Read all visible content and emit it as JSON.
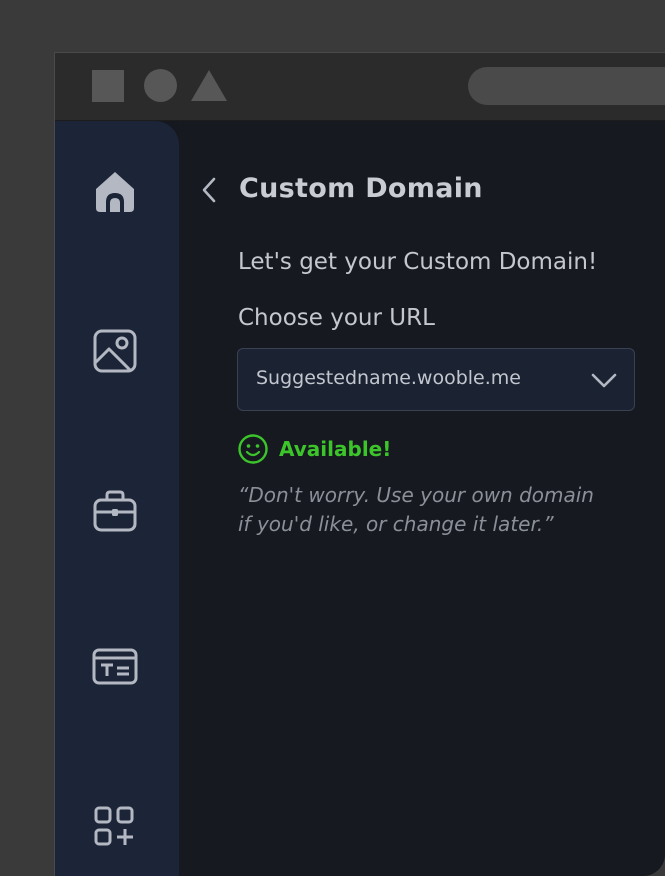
{
  "header": {
    "back_label": "back",
    "title": "Custom Domain"
  },
  "main": {
    "headline": "Let's get your Custom Domain!",
    "url_label": "Choose your URL",
    "url_select": {
      "selected_value": "Suggestedname.wooble.me"
    },
    "status": {
      "text": "Available!",
      "color": "#3cc52a",
      "icon": "smiley-icon"
    },
    "note": "“Don't worry. Use your own domain\nif you'd like, or change it later.”"
  },
  "sidebar": {
    "items": [
      {
        "icon": "home-icon",
        "active": true
      },
      {
        "icon": "image-icon",
        "active": false
      },
      {
        "icon": "briefcase-icon",
        "active": false
      },
      {
        "icon": "text-block-icon",
        "active": false
      },
      {
        "icon": "add-widget-icon",
        "active": false
      }
    ]
  },
  "titlebar": {
    "icons": [
      "square-icon",
      "circle-icon",
      "triangle-icon"
    ]
  },
  "colors": {
    "sidebar": "#1c2537",
    "content": "#161920",
    "frame": "#3a3a3a",
    "accent_success": "#3cc52a"
  }
}
